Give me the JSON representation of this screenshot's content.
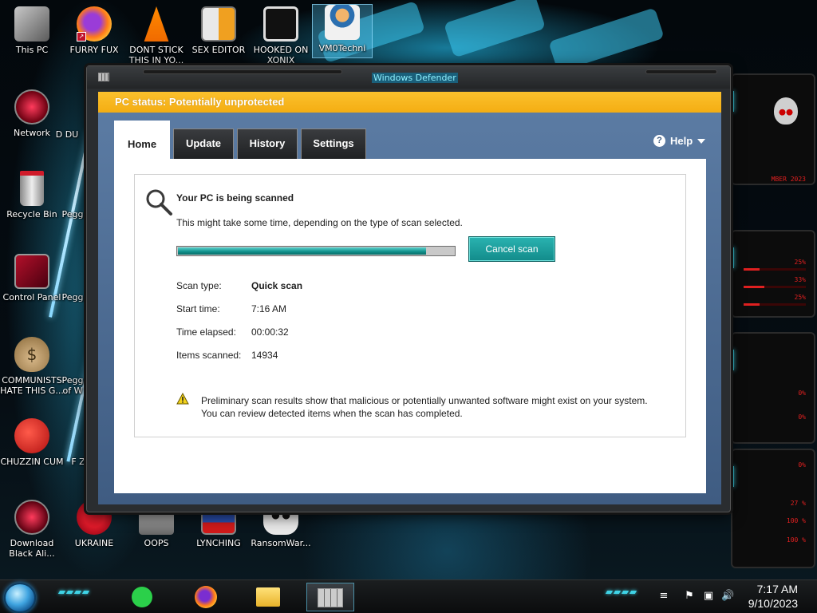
{
  "desktop": {
    "icons": [
      {
        "label": "This PC"
      },
      {
        "label": "FURRY FUX"
      },
      {
        "label": "DONT STICK THIS IN YO..."
      },
      {
        "label": "SEX EDITOR"
      },
      {
        "label": "HOOKED ON XONIX"
      },
      {
        "label": "VM0Techni"
      },
      {
        "label": "Network"
      },
      {
        "label": "D DU"
      },
      {
        "label": "Recycle Bin"
      },
      {
        "label": "Pegg"
      },
      {
        "label": "Control Panel"
      },
      {
        "label": "Pegg"
      },
      {
        "label": "COMMUNISTS HATE THIS G..."
      },
      {
        "label": "Pegg of W"
      },
      {
        "label": "CHUZZIN CUM"
      },
      {
        "label": "F Z"
      },
      {
        "label": "Download Black Ali..."
      },
      {
        "label": "UKRAINE"
      },
      {
        "label": "OOPS"
      },
      {
        "label": "LYNCHING"
      },
      {
        "label": "RansomWar..."
      }
    ]
  },
  "window": {
    "title": "Windows Defender",
    "status": "PC status: Potentially unprotected",
    "tabs": [
      {
        "label": "Home"
      },
      {
        "label": "Update"
      },
      {
        "label": "History"
      },
      {
        "label": "Settings"
      }
    ],
    "help_label": "Help",
    "scan": {
      "heading": "Your PC is being scanned",
      "subtext": "This might take some time, depending on the type of scan selected.",
      "progress": 0.9,
      "cancel_label": "Cancel scan",
      "details": [
        {
          "label": "Scan type:",
          "value": "Quick scan"
        },
        {
          "label": "Start time:",
          "value": "7:16 AM"
        },
        {
          "label": "Time elapsed:",
          "value": "00:00:32"
        },
        {
          "label": "Items scanned:",
          "value": "14934"
        }
      ],
      "warning_line1": "Preliminary scan results show that malicious or potentially unwanted software might exist on your system.",
      "warning_line2": "You can review detected items when the scan has completed."
    }
  },
  "gadget": {
    "date_text": "MBER 2023",
    "readouts": [
      "25%",
      "33%",
      "25%",
      "0%",
      "0%",
      "0%",
      "27 %",
      "100 %",
      "100 %"
    ]
  },
  "taskbar": {
    "time": "7:17 AM",
    "date": "9/10/2023"
  },
  "colors": {
    "status_bar": "#f4ad12",
    "accent_teal": "#1a9e9c",
    "window_blue": "#4f6e96"
  }
}
